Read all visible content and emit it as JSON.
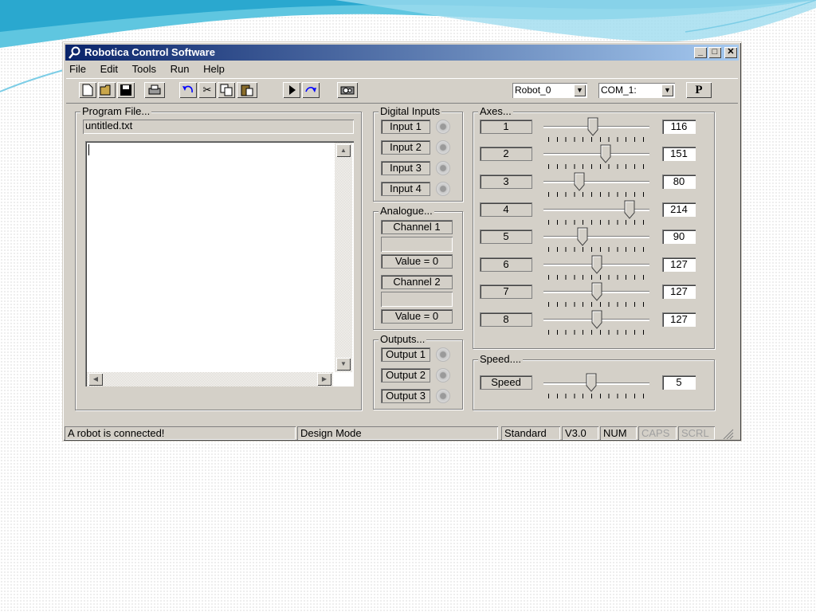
{
  "window": {
    "title": "Robotica Control Software",
    "controls": [
      "minimize-icon",
      "maximize-icon",
      "close-icon"
    ]
  },
  "menu": [
    "File",
    "Edit",
    "Tools",
    "Run",
    "Help"
  ],
  "toolbar": {
    "icons": [
      "new-file-icon",
      "open-folder-icon",
      "save-icon",
      "print-icon",
      "undo-icon",
      "cut-icon",
      "copy-icon",
      "paste-icon",
      "play-icon",
      "redo-icon",
      "camera-icon"
    ],
    "robot_select": "Robot_0",
    "port_select": "COM_1:",
    "p_button": "P"
  },
  "program_file": {
    "legend": "Program File...",
    "filename": "untitled.txt",
    "content": ""
  },
  "digital_inputs": {
    "legend": "Digital Inputs",
    "items": [
      "Input 1",
      "Input 2",
      "Input 3",
      "Input 4"
    ]
  },
  "analogue": {
    "legend": "Analogue...",
    "channels": [
      {
        "label": "Channel 1",
        "value": "Value = 0"
      },
      {
        "label": "Channel 2",
        "value": "Value = 0"
      }
    ]
  },
  "outputs": {
    "legend": "Outputs...",
    "items": [
      "Output 1",
      "Output 2",
      "Output 3"
    ]
  },
  "axes": {
    "legend": "Axes...",
    "items": [
      {
        "label": "1",
        "value": "116"
      },
      {
        "label": "2",
        "value": "151"
      },
      {
        "label": "3",
        "value": "80"
      },
      {
        "label": "4",
        "value": "214"
      },
      {
        "label": "5",
        "value": "90"
      },
      {
        "label": "6",
        "value": "127"
      },
      {
        "label": "7",
        "value": "127"
      },
      {
        "label": "8",
        "value": "127"
      }
    ]
  },
  "speed": {
    "legend": "Speed....",
    "label": "Speed",
    "value": "5"
  },
  "status_bar": {
    "message": "A robot is connected!",
    "mode": "Design Mode",
    "standard": "Standard",
    "version": "V3.0",
    "num": "NUM",
    "caps": "CAPS",
    "scrl": "SCRL"
  }
}
